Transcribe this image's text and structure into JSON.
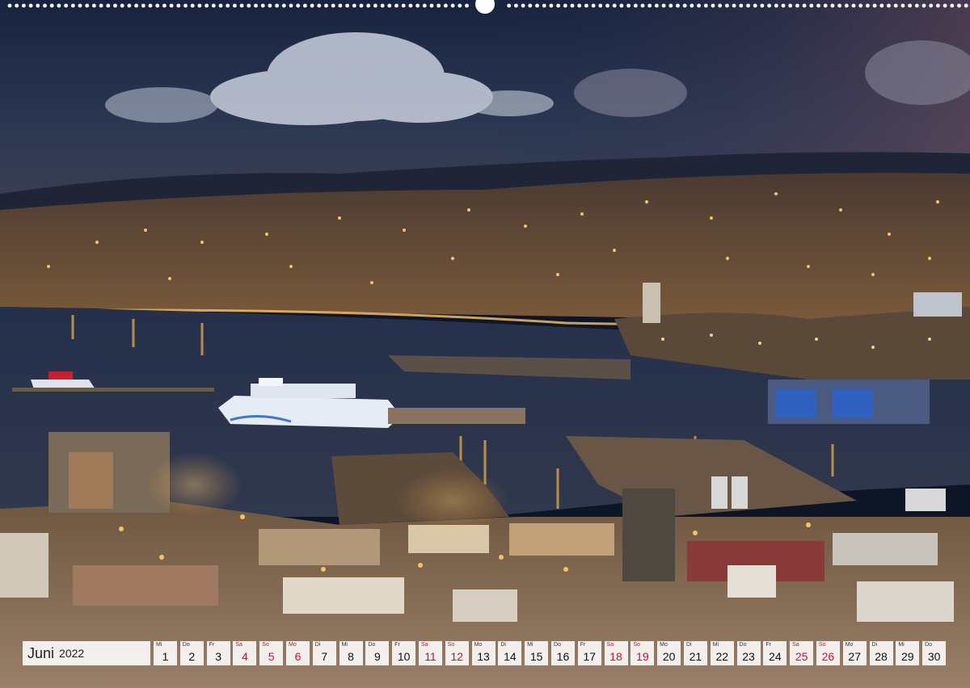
{
  "calendar": {
    "month": "Juni",
    "year": "2022",
    "days": [
      {
        "abbr": "Mi",
        "num": "1",
        "red": false
      },
      {
        "abbr": "Do",
        "num": "2",
        "red": false
      },
      {
        "abbr": "Fr",
        "num": "3",
        "red": false
      },
      {
        "abbr": "Sa",
        "num": "4",
        "red": true
      },
      {
        "abbr": "So",
        "num": "5",
        "red": true
      },
      {
        "abbr": "Mo",
        "num": "6",
        "red": true
      },
      {
        "abbr": "Di",
        "num": "7",
        "red": false
      },
      {
        "abbr": "Mi",
        "num": "8",
        "red": false
      },
      {
        "abbr": "Do",
        "num": "9",
        "red": false
      },
      {
        "abbr": "Fr",
        "num": "10",
        "red": false
      },
      {
        "abbr": "Sa",
        "num": "11",
        "red": true
      },
      {
        "abbr": "So",
        "num": "12",
        "red": true
      },
      {
        "abbr": "Mo",
        "num": "13",
        "red": false
      },
      {
        "abbr": "Di",
        "num": "14",
        "red": false
      },
      {
        "abbr": "Mi",
        "num": "15",
        "red": false
      },
      {
        "abbr": "Do",
        "num": "16",
        "red": false
      },
      {
        "abbr": "Fr",
        "num": "17",
        "red": false
      },
      {
        "abbr": "Sa",
        "num": "18",
        "red": true
      },
      {
        "abbr": "So",
        "num": "19",
        "red": true
      },
      {
        "abbr": "Mo",
        "num": "20",
        "red": false
      },
      {
        "abbr": "Di",
        "num": "21",
        "red": false
      },
      {
        "abbr": "Mi",
        "num": "22",
        "red": false
      },
      {
        "abbr": "Do",
        "num": "23",
        "red": false
      },
      {
        "abbr": "Fr",
        "num": "24",
        "red": false
      },
      {
        "abbr": "Sa",
        "num": "25",
        "red": true
      },
      {
        "abbr": "So",
        "num": "26",
        "red": true
      },
      {
        "abbr": "Mo",
        "num": "27",
        "red": false
      },
      {
        "abbr": "Di",
        "num": "28",
        "red": false
      },
      {
        "abbr": "Mi",
        "num": "29",
        "red": false
      },
      {
        "abbr": "Do",
        "num": "30",
        "red": false
      }
    ]
  },
  "colors": {
    "sky_top": "#1b2a4a",
    "sky_bottom": "#3a4660",
    "water": "#2b3550",
    "city_light": "#f3b24a",
    "holiday_red": "#c8102e"
  }
}
